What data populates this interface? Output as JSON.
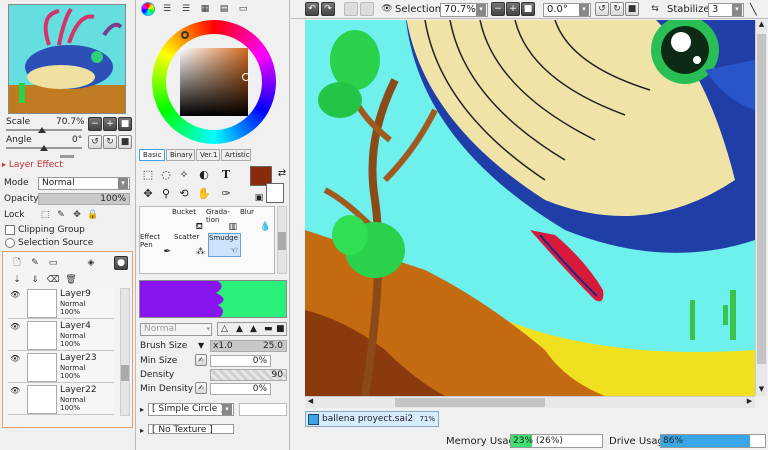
{
  "navigator": {
    "scale_label": "Scale",
    "scale_value": "70.7%",
    "angle_label": "Angle",
    "angle_value": "0°"
  },
  "layer_effect": {
    "title": "Layer Effect",
    "mode_label": "Mode",
    "mode_value": "Normal",
    "opacity_label": "Opacity",
    "opacity_value": "100%",
    "lock_label": "Lock",
    "clipping_group": "Clipping Group",
    "selection_source": "Selection Source"
  },
  "layers": [
    {
      "name": "Layer9",
      "mode": "Normal",
      "opacity": "100%"
    },
    {
      "name": "Layer4",
      "mode": "Normal",
      "opacity": "100%"
    },
    {
      "name": "Layer23",
      "mode": "Normal",
      "opacity": "100%"
    },
    {
      "name": "Layer22",
      "mode": "Normal",
      "opacity": "100%"
    }
  ],
  "color_tabs": [
    "Basic",
    "Binary",
    "Ver.1",
    "Artistic"
  ],
  "brush_tools": [
    {
      "label": "Bucket"
    },
    {
      "label": "Grada-\ntion"
    },
    {
      "label": "Blur"
    },
    {
      "label": "Effect\nPen"
    },
    {
      "label": "Scatter"
    },
    {
      "label": "Smudge"
    }
  ],
  "brush_settings": {
    "blend_mode": "Normal",
    "brush_size_label": "Brush Size",
    "brush_size_mult": "x1.0",
    "brush_size_value": "25.0",
    "min_size_label": "Min Size",
    "min_size_value": "0%",
    "density_label": "Density",
    "density_value": "90",
    "min_density_label": "Min Density",
    "min_density_value": "0%",
    "shape": "[ Simple Circle ]",
    "texture": "[ No Texture ]"
  },
  "toolbar": {
    "selection_label": "Selection",
    "zoom_value": "70.7%",
    "rotation_value": "0.0°",
    "stabilizer_label": "Stabilizer",
    "stabilizer_value": "3"
  },
  "document_tab": {
    "name": "ballena proyect.sai2",
    "zoom": "71%"
  },
  "status": {
    "memory_label": "Memory Usage",
    "memory_value": "23% (26%)",
    "memory_fraction": 0.23,
    "drive_label": "Drive Usage",
    "drive_value": "86%",
    "drive_fraction": 0.86
  },
  "colors": {
    "current_color": "#8b2a0a",
    "canvas_sky": "#6ef0ec",
    "accent": "#3aa6e6"
  }
}
